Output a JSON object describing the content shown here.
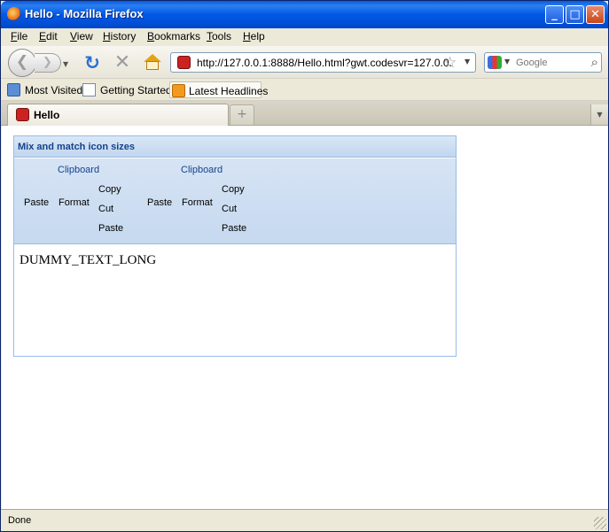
{
  "window": {
    "title": "Hello - Mozilla Firefox"
  },
  "menu": [
    "File",
    "Edit",
    "View",
    "History",
    "Bookmarks",
    "Tools",
    "Help"
  ],
  "nav": {
    "url": "http://127.0.0.1:8888/Hello.html?gwt.codesvr=127.0.0.",
    "search_placeholder": "Google"
  },
  "bookmarks": [
    {
      "label": "Most Visited",
      "icon": "folder-icon"
    },
    {
      "label": "Getting Started",
      "icon": "page-icon"
    },
    {
      "label": "Latest Headlines",
      "icon": "rss-icon"
    }
  ],
  "tabs": [
    {
      "label": "Hello"
    }
  ],
  "panel": {
    "title": "Mix and match icon sizes",
    "groups": [
      {
        "title": "Clipboard",
        "large": [
          "Paste",
          "Format"
        ],
        "small": [
          "Copy",
          "Cut",
          "Paste"
        ]
      },
      {
        "title": "Clipboard",
        "large": [
          "Paste",
          "Format"
        ],
        "small": [
          "Copy",
          "Cut",
          "Paste"
        ]
      }
    ],
    "body": "DUMMY_TEXT_LONG"
  },
  "status": {
    "text": "Done"
  },
  "colors": {
    "titlebar": "#0058e6",
    "panel_border": "#99bbe8",
    "panel_title": "#15428b"
  }
}
